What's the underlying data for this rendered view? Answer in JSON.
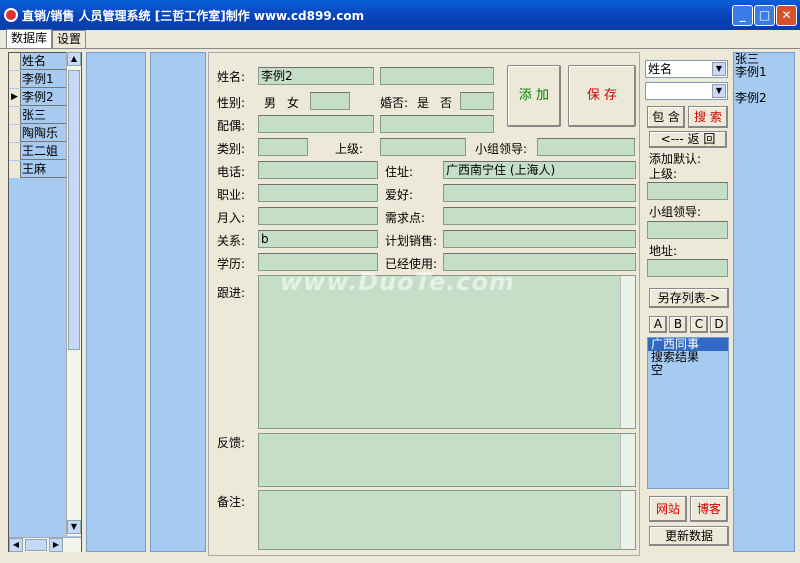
{
  "window": {
    "title": "直销/销售 人员管理系统 [三哲工作室]制作 www.cd899.com"
  },
  "tabs": [
    "数据库",
    "设置"
  ],
  "grid": {
    "header": "姓名",
    "rows": [
      "李例1",
      "李例2",
      "张三",
      "陶陶乐",
      "王二姐",
      "王麻"
    ],
    "current_row_marker": "▶"
  },
  "form": {
    "name_label": "姓名:",
    "name_value": "李例2",
    "gender_label": "性别:",
    "male": "男",
    "female": "女",
    "married_label": "婚否:",
    "yes": "是",
    "no": "否",
    "spouse_label": "配偶:",
    "category_label": "类别:",
    "superior_label": "上级:",
    "group_leader_label": "小组领导:",
    "phone_label": "电话:",
    "address_label": "住址:",
    "address_value": "广西南宁住 (上海人)",
    "job_label": "职业:",
    "hobby_label": "爱好:",
    "income_label": "月入:",
    "needs_label": "需求点:",
    "relation_label": "关系:",
    "relation_value": "b",
    "plan_label": "计划销售:",
    "edu_label": "学历:",
    "used_label": "已经使用:",
    "followup_label": "跟进:",
    "feedback_label": "反馈:",
    "notes_label": "备注:"
  },
  "buttons": {
    "add": "添 加",
    "save": "保 存",
    "contains": "包 含",
    "search": "搜 索",
    "back": "<--- 返 回",
    "save_list": "另存列表->",
    "a": "A",
    "b": "B",
    "c": "C",
    "d": "D",
    "website": "网站",
    "blog": "博客",
    "update": "更新数据"
  },
  "right": {
    "field_select": "姓名",
    "field_select2": "",
    "default_label": "添加默认:",
    "superior_label": "上级:",
    "leader_label": "小组领导:",
    "address_label": "地址:",
    "list_items": [
      "广西同事",
      "搜索结果",
      "空"
    ]
  },
  "far_right": {
    "items": [
      "张三",
      "李例1",
      "李例2"
    ]
  },
  "watermark": "www.DuoTe.com",
  "colors": {
    "accent_red": "#d40000",
    "accent_green": "#008000",
    "field_bg": "#c5dec8",
    "panel_blue": "#a6caf0"
  }
}
